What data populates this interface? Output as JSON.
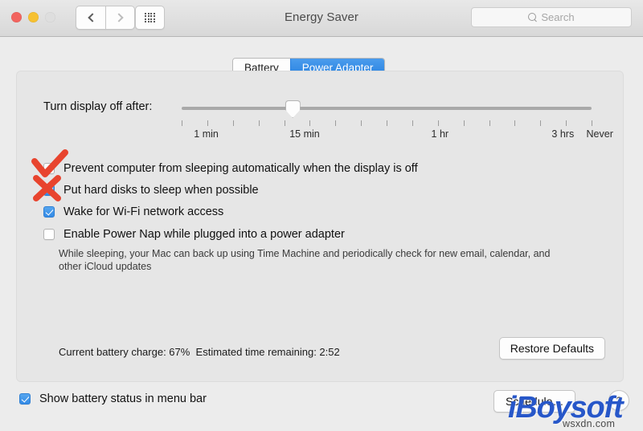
{
  "window": {
    "title": "Energy Saver",
    "traffic_lights": [
      {
        "name": "close",
        "color": "#f2645f",
        "enabled": true
      },
      {
        "name": "minimize",
        "color": "#f6c132",
        "enabled": true
      },
      {
        "name": "zoom",
        "color": "#dedede",
        "enabled": false
      }
    ],
    "nav": {
      "back_icon": "chevron-left-icon",
      "forward_icon": "chevron-right-icon",
      "show_all_icon": "grid-icon"
    }
  },
  "search": {
    "placeholder": "Search",
    "value": "",
    "icon": "search-icon"
  },
  "tabs": [
    {
      "label": "Battery",
      "active": false
    },
    {
      "label": "Power Adapter",
      "active": true
    }
  ],
  "slider": {
    "label": "Turn display off after:",
    "value_label": "15 min",
    "thumb_percent": 27,
    "tick_count": 17,
    "tick_labels": [
      {
        "text": "1 min",
        "percent": 6
      },
      {
        "text": "15 min",
        "percent": 30
      },
      {
        "text": "1 hr",
        "percent": 63
      },
      {
        "text": "3 hrs",
        "percent": 93
      },
      {
        "text": "Never",
        "percent": 102
      }
    ]
  },
  "options": [
    {
      "id": "prevent-sleep",
      "label": "Prevent computer from sleeping automatically when the display is off",
      "checked": false,
      "annotation": "red-check"
    },
    {
      "id": "hard-disks-sleep",
      "label": "Put hard disks to sleep when possible",
      "checked": true,
      "annotation": "red-cross"
    },
    {
      "id": "wake-wifi",
      "label": "Wake for Wi-Fi network access",
      "checked": true,
      "annotation": null
    },
    {
      "id": "power-nap",
      "label": "Enable Power Nap while plugged into a power adapter",
      "checked": false,
      "annotation": null
    }
  ],
  "power_nap_description": "While sleeping, your Mac can back up using Time Machine and periodically check for new email,\ncalendar, and other iCloud updates",
  "status": {
    "battery_text": "Current battery charge: 67%  Estimated time remaining: 2:52",
    "battery_charge": "67%",
    "time_remaining": "2:52"
  },
  "buttons": {
    "restore_defaults": "Restore Defaults",
    "schedule": "Schedule…",
    "help": "?"
  },
  "bottom": {
    "show_battery_label": "Show battery status in menu bar",
    "show_battery_checked": true
  },
  "watermark": {
    "brand": "iBoysoft",
    "domain": "wsxdn.com",
    "brand_color": "#2757c9"
  },
  "annotation_color": "#e8442e"
}
